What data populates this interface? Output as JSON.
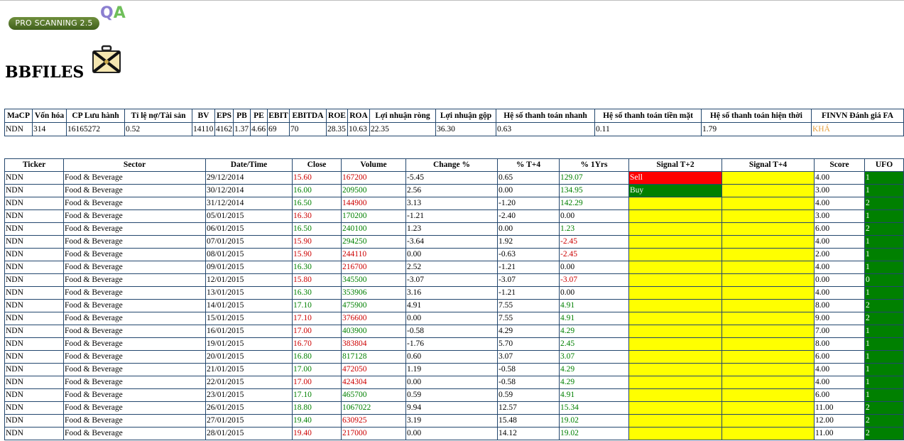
{
  "logo": {
    "text": "PRO SCANNING 2.5",
    "badge": "QA",
    "colors": {
      "pill": "#4a6a25",
      "q": "#8b7fd0",
      "a": "#6fbf5a"
    }
  },
  "brand": {
    "title": "BBFILES",
    "icon": "briefcase-icon"
  },
  "fa": {
    "headers": [
      "MaCP",
      "Vốn hóa",
      "CP Lưu hành",
      "Tỉ lệ nợ/Tài sản",
      "BV",
      "EPS",
      "PB",
      "PE",
      "EBIT",
      "EBITDA",
      "ROE",
      "ROA",
      "Lợi nhuận ròng",
      "Lợi nhuận gộp",
      "Hệ số thanh toán nhanh",
      "Hệ số thanh toán tiền mặt",
      "Hệ số thanh toán hiện thời",
      "FINVN Đánh giá FA"
    ],
    "row": [
      "NDN",
      "314",
      "16165272",
      "0.52",
      "14110",
      "4162",
      "1.37",
      "4.66",
      "69",
      "70",
      "28.35",
      "10.63",
      "22.35",
      "36.30",
      "0.63",
      "0.11",
      "1.79",
      "KHÁ"
    ],
    "rating_color": "#e6a040"
  },
  "signals": {
    "headers": [
      "Ticker",
      "Sector",
      "Date/Time",
      "Close",
      "Volume",
      "Change %",
      "% T+4",
      "% 1Yrs",
      "Signal T+2",
      "Signal T+4",
      "Score",
      "UFO"
    ],
    "colors": {
      "red": "#cc0000",
      "green": "#008000",
      "yellow": "#ffff00",
      "sell": "#ff0000"
    },
    "rows": [
      {
        "ticker": "NDN",
        "sector": "Food & Beverage",
        "date": "29/12/2014",
        "close": "15.60",
        "close_c": "red",
        "volume": "167200",
        "vol_c": "red",
        "change": "-5.45",
        "t4": "0.65",
        "yr": "129.07",
        "yr_c": "green",
        "sig2": "Sell",
        "sig2_c": "sell",
        "score": "4.00",
        "ufo": "1"
      },
      {
        "ticker": "NDN",
        "sector": "Food & Beverage",
        "date": "30/12/2014",
        "close": "16.00",
        "close_c": "green",
        "volume": "209500",
        "vol_c": "green",
        "change": "2.56",
        "t4": "0.00",
        "yr": "134.95",
        "yr_c": "green",
        "sig2": "Buy",
        "sig2_c": "buy",
        "score": "3.00",
        "ufo": "1"
      },
      {
        "ticker": "NDN",
        "sector": "Food & Beverage",
        "date": "31/12/2014",
        "close": "16.50",
        "close_c": "green",
        "volume": "144900",
        "vol_c": "red",
        "change": "3.13",
        "t4": "-1.20",
        "yr": "142.29",
        "yr_c": "green",
        "sig2": "",
        "sig2_c": "yellow",
        "score": "4.00",
        "ufo": "2"
      },
      {
        "ticker": "NDN",
        "sector": "Food & Beverage",
        "date": "05/01/2015",
        "close": "16.30",
        "close_c": "red",
        "volume": "170200",
        "vol_c": "green",
        "change": "-1.21",
        "t4": "-2.40",
        "yr": "0.00",
        "yr_c": "",
        "sig2": "",
        "sig2_c": "yellow",
        "score": "3.00",
        "ufo": "1"
      },
      {
        "ticker": "NDN",
        "sector": "Food & Beverage",
        "date": "06/01/2015",
        "close": "16.50",
        "close_c": "green",
        "volume": "240100",
        "vol_c": "green",
        "change": "1.23",
        "t4": "0.00",
        "yr": "1.23",
        "yr_c": "green",
        "sig2": "",
        "sig2_c": "yellow",
        "score": "6.00",
        "ufo": "2"
      },
      {
        "ticker": "NDN",
        "sector": "Food & Beverage",
        "date": "07/01/2015",
        "close": "15.90",
        "close_c": "red",
        "volume": "294250",
        "vol_c": "green",
        "change": "-3.64",
        "t4": "1.92",
        "yr": "-2.45",
        "yr_c": "red",
        "sig2": "",
        "sig2_c": "yellow",
        "score": "4.00",
        "ufo": "1"
      },
      {
        "ticker": "NDN",
        "sector": "Food & Beverage",
        "date": "08/01/2015",
        "close": "15.90",
        "close_c": "red",
        "volume": "244110",
        "vol_c": "red",
        "change": "0.00",
        "t4": "-0.63",
        "yr": "-2.45",
        "yr_c": "red",
        "sig2": "",
        "sig2_c": "yellow",
        "score": "2.00",
        "ufo": "1"
      },
      {
        "ticker": "NDN",
        "sector": "Food & Beverage",
        "date": "09/01/2015",
        "close": "16.30",
        "close_c": "green",
        "volume": "216700",
        "vol_c": "red",
        "change": "2.52",
        "t4": "-1.21",
        "yr": "0.00",
        "yr_c": "",
        "sig2": "",
        "sig2_c": "yellow",
        "score": "4.00",
        "ufo": "1"
      },
      {
        "ticker": "NDN",
        "sector": "Food & Beverage",
        "date": "12/01/2015",
        "close": "15.80",
        "close_c": "red",
        "volume": "345500",
        "vol_c": "green",
        "change": "-3.07",
        "t4": "-3.07",
        "yr": "-3.07",
        "yr_c": "red",
        "sig2": "",
        "sig2_c": "yellow",
        "score": "0.00",
        "ufo": "0"
      },
      {
        "ticker": "NDN",
        "sector": "Food & Beverage",
        "date": "13/01/2015",
        "close": "16.30",
        "close_c": "green",
        "volume": "353906",
        "vol_c": "green",
        "change": "3.16",
        "t4": "-1.21",
        "yr": "0.00",
        "yr_c": "",
        "sig2": "",
        "sig2_c": "yellow",
        "score": "4.00",
        "ufo": "1"
      },
      {
        "ticker": "NDN",
        "sector": "Food & Beverage",
        "date": "14/01/2015",
        "close": "17.10",
        "close_c": "green",
        "volume": "475900",
        "vol_c": "green",
        "change": "4.91",
        "t4": "7.55",
        "yr": "4.91",
        "yr_c": "green",
        "sig2": "",
        "sig2_c": "yellow",
        "score": "8.00",
        "ufo": "2"
      },
      {
        "ticker": "NDN",
        "sector": "Food & Beverage",
        "date": "15/01/2015",
        "close": "17.10",
        "close_c": "red",
        "volume": "376600",
        "vol_c": "red",
        "change": "0.00",
        "t4": "7.55",
        "yr": "4.91",
        "yr_c": "green",
        "sig2": "",
        "sig2_c": "yellow",
        "score": "9.00",
        "ufo": "2"
      },
      {
        "ticker": "NDN",
        "sector": "Food & Beverage",
        "date": "16/01/2015",
        "close": "17.00",
        "close_c": "red",
        "volume": "403900",
        "vol_c": "green",
        "change": "-0.58",
        "t4": "4.29",
        "yr": "4.29",
        "yr_c": "green",
        "sig2": "",
        "sig2_c": "yellow",
        "score": "7.00",
        "ufo": "1"
      },
      {
        "ticker": "NDN",
        "sector": "Food & Beverage",
        "date": "19/01/2015",
        "close": "16.70",
        "close_c": "red",
        "volume": "383804",
        "vol_c": "red",
        "change": "-1.76",
        "t4": "5.70",
        "yr": "2.45",
        "yr_c": "green",
        "sig2": "",
        "sig2_c": "yellow",
        "score": "8.00",
        "ufo": "1"
      },
      {
        "ticker": "NDN",
        "sector": "Food & Beverage",
        "date": "20/01/2015",
        "close": "16.80",
        "close_c": "green",
        "volume": "817128",
        "vol_c": "green",
        "change": "0.60",
        "t4": "3.07",
        "yr": "3.07",
        "yr_c": "green",
        "sig2": "",
        "sig2_c": "yellow",
        "score": "6.00",
        "ufo": "1"
      },
      {
        "ticker": "NDN",
        "sector": "Food & Beverage",
        "date": "21/01/2015",
        "close": "17.00",
        "close_c": "green",
        "volume": "472050",
        "vol_c": "red",
        "change": "1.19",
        "t4": "-0.58",
        "yr": "4.29",
        "yr_c": "green",
        "sig2": "",
        "sig2_c": "yellow",
        "score": "4.00",
        "ufo": "1"
      },
      {
        "ticker": "NDN",
        "sector": "Food & Beverage",
        "date": "22/01/2015",
        "close": "17.00",
        "close_c": "red",
        "volume": "424304",
        "vol_c": "red",
        "change": "0.00",
        "t4": "-0.58",
        "yr": "4.29",
        "yr_c": "green",
        "sig2": "",
        "sig2_c": "yellow",
        "score": "4.00",
        "ufo": "1"
      },
      {
        "ticker": "NDN",
        "sector": "Food & Beverage",
        "date": "23/01/2015",
        "close": "17.10",
        "close_c": "green",
        "volume": "465700",
        "vol_c": "green",
        "change": "0.59",
        "t4": "0.59",
        "yr": "4.91",
        "yr_c": "green",
        "sig2": "",
        "sig2_c": "yellow",
        "score": "6.00",
        "ufo": "1"
      },
      {
        "ticker": "NDN",
        "sector": "Food & Beverage",
        "date": "26/01/2015",
        "close": "18.80",
        "close_c": "green",
        "volume": "1067022",
        "vol_c": "green",
        "change": "9.94",
        "t4": "12.57",
        "yr": "15.34",
        "yr_c": "green",
        "sig2": "",
        "sig2_c": "yellow",
        "score": "11.00",
        "ufo": "2"
      },
      {
        "ticker": "NDN",
        "sector": "Food & Beverage",
        "date": "27/01/2015",
        "close": "19.40",
        "close_c": "green",
        "volume": "630925",
        "vol_c": "red",
        "change": "3.19",
        "t4": "15.48",
        "yr": "19.02",
        "yr_c": "green",
        "sig2": "",
        "sig2_c": "yellow",
        "score": "12.00",
        "ufo": "2"
      },
      {
        "ticker": "NDN",
        "sector": "Food & Beverage",
        "date": "28/01/2015",
        "close": "19.40",
        "close_c": "red",
        "volume": "217000",
        "vol_c": "red",
        "change": "0.00",
        "t4": "14.12",
        "yr": "19.02",
        "yr_c": "green",
        "sig2": "",
        "sig2_c": "yellow",
        "score": "11.00",
        "ufo": "2"
      }
    ]
  }
}
